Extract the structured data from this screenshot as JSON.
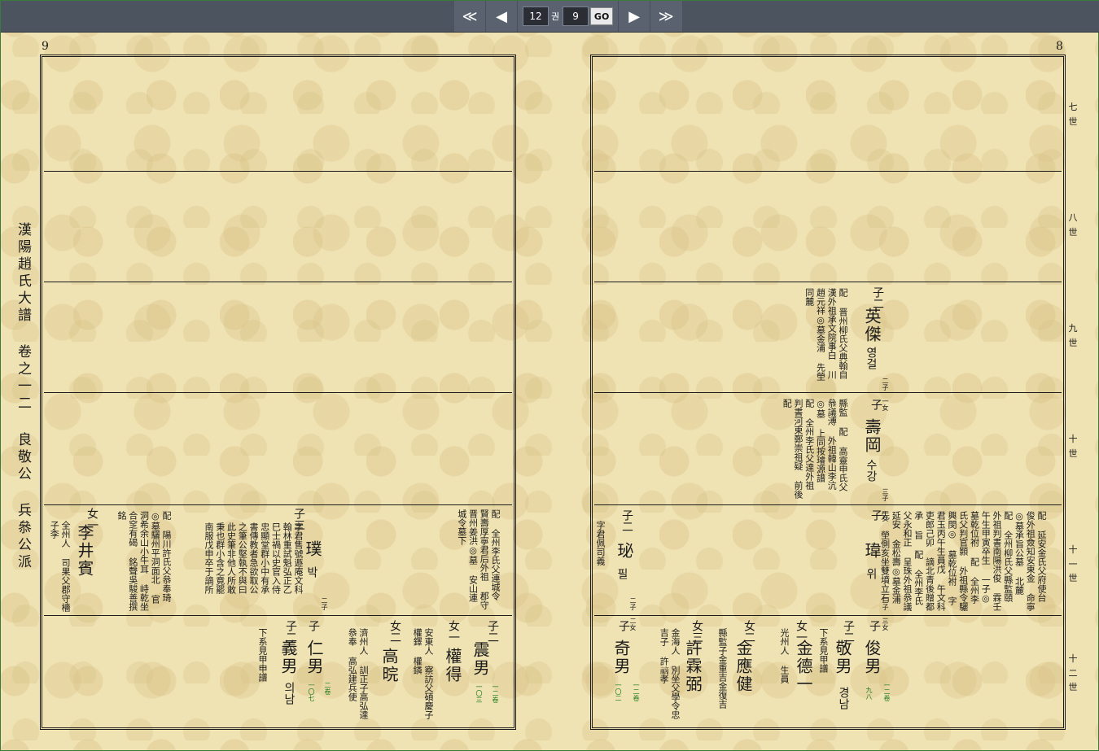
{
  "nav": {
    "first": "≪",
    "prev": "◀",
    "volume": "12",
    "volume_unit": "권",
    "page": "9",
    "go": "GO",
    "next": "▶",
    "last": "≫"
  },
  "left_page_number": "9",
  "right_page_number": "8",
  "side_title": "漢陽趙氏大譜 卷之一二 良敬公 兵叅公派",
  "generations": [
    "七世",
    "八世",
    "九世",
    "十世",
    "十一世",
    "十二世"
  ],
  "right_page": {
    "row9": [
      {
        "head": "子二",
        "name": "英傑",
        "reading": "영걸",
        "note": "二子 一女"
      },
      {
        "text": "配 晋州柳氏父典翰自 漢外祖承文院事白 川趙元祥◎墓金浦 先塋同麓"
      }
    ],
    "row10": [
      {
        "head": "子",
        "name": "壽岡",
        "reading": "수강",
        "note": "三子 一女"
      },
      {
        "text": "縣監 配 高靈申氏父叅議溥 外祖韓山李沆◎墓 上同按璿源譜 配 全州李氏父達外祖 判書河東鄭崇祖疑 前後配"
      }
    ],
    "row11": [
      {
        "head": "子",
        "name": "瑋",
        "reading": "위",
        "note": "二子 三女"
      },
      {
        "head": "子二",
        "name": "珌",
        "reading": "필",
        "note": "二子 二女",
        "sub": "字君佩司義"
      },
      {
        "text": "配 延安金氏父府使台 俊外祖僉知安東金 命寧◎墓承旨公墓 北麓 配 全州柳氏父縣監頤 外祖判書南陽洪俊 霖壬午生甲寅卒生 一子◎墓乾位祔 配 全州李氏父判官顥 外祖縣令驪興閔◎ 墓乾位祔 字君玉丙午生員戊 午文科吏郎己卯 謫北青後贈都承 旨 配 全州李氏父永和正 呈珠外祖叅議延安 金松壽◎墓金浦先 塋側亥坐雙墳立石"
      }
    ],
    "row12": [
      {
        "head": "子",
        "name": "俊男",
        "vol": "一二卷",
        "page": "九八"
      },
      {
        "head": "子二",
        "name": "敬男",
        "reading": "경남",
        "sub": "下系見甲譜"
      },
      {
        "head": "女一",
        "name": "金德一",
        "sub": "光州人 生員"
      },
      {
        "head": "女二",
        "name": "金應健",
        "sub": "縣監子金重吉金復吉"
      },
      {
        "head": "女三",
        "name": "許霖弼",
        "sub": "金海人 別坐父學令忠吉子 許𥛚孝"
      },
      {
        "head": "子",
        "name": "奇男",
        "vol": "一二卷",
        "page": "一〇二"
      }
    ]
  },
  "left_page": {
    "row11": [
      {
        "text": "配 全州李氏父連城令 賢壽厚寧君后外祖 郡守晋州姜洪◎墓 安山連城令墓下"
      },
      {
        "head": "子三",
        "name": "璞",
        "reading": "박",
        "note": "二子",
        "sub": "字君售號遯庵文科 翰林重試魁弘正乙 巳士禍以史官入侍 忠顯堂群小中有承 書傳教者急欲取公 之筆公堅執不與曰 此史筆非他人所敢 秉也群小含之竟罷 南服戊申卒于謫所"
      },
      {
        "text": "配 陽川許氏父叅奉琦 ◎墓驪州平洞面北 官洞希余山小牛耳 峙乾坐合窆有碣 銘聲吳駿善撰銘"
      },
      {
        "head": "女一",
        "name": "李井賓",
        "sub": "全州人 司果父郡守檣子李"
      }
    ],
    "row12": [
      {
        "head": "子二",
        "name": "震男",
        "vol": "一二卷",
        "page": "一〇三"
      },
      {
        "head": "女一",
        "name": "權得",
        "sub": "安東人 察訪父碩慶子權鐸 權鏻"
      },
      {
        "head": "女二",
        "name": "高晥",
        "sub": "濟州人 訓正子高弘達叅奉 高弘建兵使"
      },
      {
        "head": "子",
        "name": "仁男",
        "vol": "二卷",
        "page": "一〇七"
      },
      {
        "head": "子二",
        "name": "義男",
        "reading": "의남",
        "sub": "下系見甲申譜"
      }
    ]
  }
}
